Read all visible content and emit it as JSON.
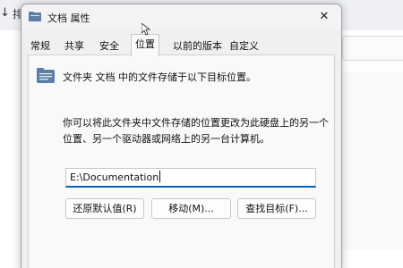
{
  "background_window": {
    "toolbar_arrow": "↓",
    "toolbar_label": "排"
  },
  "dialog": {
    "title": "文档 属性",
    "close_glyph": "✕",
    "tabs": [
      {
        "label": "常规",
        "active": false
      },
      {
        "label": "共享",
        "active": false
      },
      {
        "label": "安全",
        "active": false
      },
      {
        "label": "位置",
        "active": true
      },
      {
        "label": "以前的版本",
        "active": false
      },
      {
        "label": "自定义",
        "active": false
      }
    ],
    "location_tab": {
      "info_text": "文件夹 文档 中的文件存储于以下目标位置。",
      "description": "你可以将此文件夹中文件存储的位置更改为此硬盘上的另一个位置、另一个驱动器或网络上的另一台计算机。",
      "path_value": "E:\\Documentation",
      "buttons": {
        "restore_default": "还原默认值(R)",
        "move": "移动(M)...",
        "find_target": "查找目标(F)..."
      }
    }
  },
  "icons": {
    "title_icon": "folder-properties-icon",
    "folder_icon": "documents-folder-icon",
    "close_icon": "close-icon",
    "cursor": "mouse-pointer-icon"
  },
  "colors": {
    "accent": "#0067c0",
    "dialog_bg": "#f0f0f0",
    "panel_bg": "#f9f9f9",
    "folder_blue": "#5b7fa6"
  }
}
